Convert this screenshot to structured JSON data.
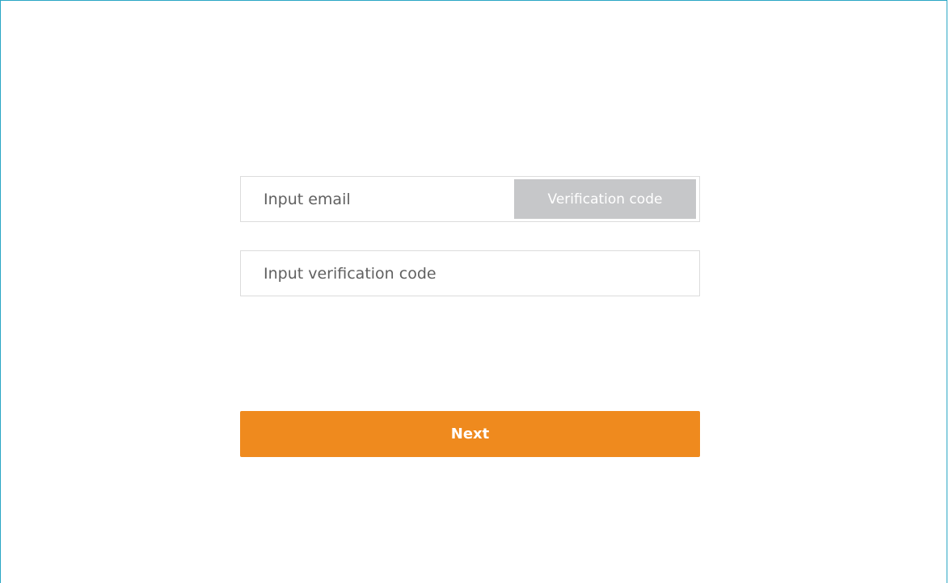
{
  "form": {
    "email": {
      "value": "",
      "placeholder": "Input email"
    },
    "send_code_label": "Verification code",
    "verification": {
      "value": "",
      "placeholder": "Input verification code"
    },
    "next_label": "Next"
  },
  "colors": {
    "frame_border": "#2aa6c4",
    "input_border": "#dcdcdc",
    "code_button_bg": "#c6c7c9",
    "primary": "#ef8a1e",
    "button_text": "#ffffff"
  }
}
